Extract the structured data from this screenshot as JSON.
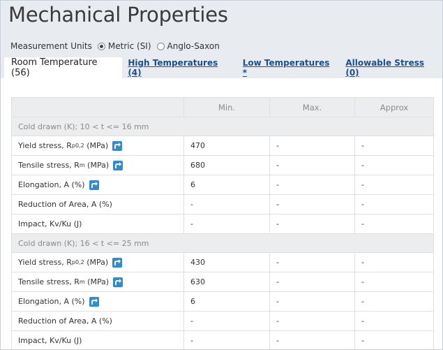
{
  "page_title": "Mechanical Properties",
  "units": {
    "label": "Measurement Units",
    "options": [
      "Metric (SI)",
      "Anglo-Saxon"
    ],
    "selected": "Metric (SI)"
  },
  "tabs": [
    {
      "label": "Room Temperature (56)",
      "active": true
    },
    {
      "label": "High Temperatures (4)",
      "active": false
    },
    {
      "label": "Low Temperatures *",
      "active": false
    },
    {
      "label": "Allowable Stress (0)",
      "active": false
    }
  ],
  "table": {
    "headers": [
      "",
      "Min.",
      "Max.",
      "Approx"
    ],
    "groups": [
      {
        "title": "Cold drawn (K); 10 < t <= 16 mm",
        "rows": [
          {
            "prop": "Yield stress, R",
            "sub": "p0,2",
            "unit": " (MPa)",
            "chart": true,
            "min": "470",
            "max": "-",
            "approx": "-"
          },
          {
            "prop": "Tensile stress, R",
            "sub": "m",
            "unit": " (MPa)",
            "chart": true,
            "min": "680",
            "max": "-",
            "approx": "-"
          },
          {
            "prop": "Elongation, A (%)",
            "sub": "",
            "unit": "",
            "chart": true,
            "min": "6",
            "max": "-",
            "approx": "-"
          },
          {
            "prop": "Reduction of Area, A (%)",
            "sub": "",
            "unit": "",
            "chart": false,
            "min": "-",
            "max": "-",
            "approx": "-"
          },
          {
            "prop": "Impact, Kv/Ku (J)",
            "sub": "",
            "unit": "",
            "chart": false,
            "min": "-",
            "max": "-",
            "approx": "-"
          }
        ]
      },
      {
        "title": "Cold drawn (K); 16 < t <= 25 mm",
        "rows": [
          {
            "prop": "Yield stress, R",
            "sub": "p0,2",
            "unit": " (MPa)",
            "chart": true,
            "min": "430",
            "max": "-",
            "approx": "-"
          },
          {
            "prop": "Tensile stress, R",
            "sub": "m",
            "unit": " (MPa)",
            "chart": true,
            "min": "630",
            "max": "-",
            "approx": "-"
          },
          {
            "prop": "Elongation, A (%)",
            "sub": "",
            "unit": "",
            "chart": true,
            "min": "6",
            "max": "-",
            "approx": "-"
          },
          {
            "prop": "Reduction of Area, A (%)",
            "sub": "",
            "unit": "",
            "chart": false,
            "min": "-",
            "max": "-",
            "approx": "-"
          },
          {
            "prop": "Impact, Kv/Ku (J)",
            "sub": "",
            "unit": "",
            "chart": false,
            "min": "-",
            "max": "-",
            "approx": "-"
          }
        ]
      }
    ]
  },
  "icons": {
    "chart_button": "chart-trend-icon"
  },
  "colors": {
    "link": "#1a4e9a",
    "icon_blue": "#2f8bd4",
    "header_bg": "#ecedef",
    "page_bg": "#e8ecf1"
  }
}
